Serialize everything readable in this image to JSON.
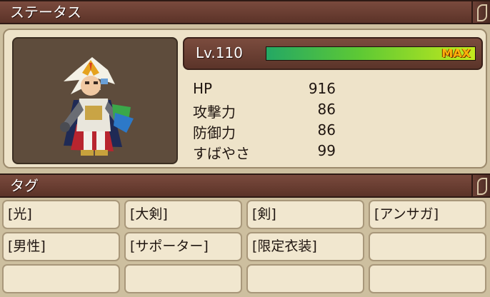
{
  "status_header": {
    "title": "ステータス"
  },
  "level": {
    "label": "Lv.110",
    "badge": "MAX",
    "progress_percent": 100
  },
  "stats": [
    {
      "label": "HP",
      "value": "916"
    },
    {
      "label": "攻撃力",
      "value": "86"
    },
    {
      "label": "防御力",
      "value": "86"
    },
    {
      "label": "すばやさ",
      "value": "99"
    }
  ],
  "tags_header": {
    "title": "タグ"
  },
  "tags": [
    "[光]",
    "[大剣]",
    "[剣]",
    "[アンサガ]",
    "[男性]",
    "[サポーター]",
    "[限定衣装]",
    "",
    "",
    "",
    "",
    ""
  ],
  "colors": {
    "header_bg": "#6b3f33",
    "panel_bg": "#eee3c9",
    "bar_start": "#24a864",
    "bar_end": "#c4ea1d",
    "max_text": "#ffb20a"
  }
}
